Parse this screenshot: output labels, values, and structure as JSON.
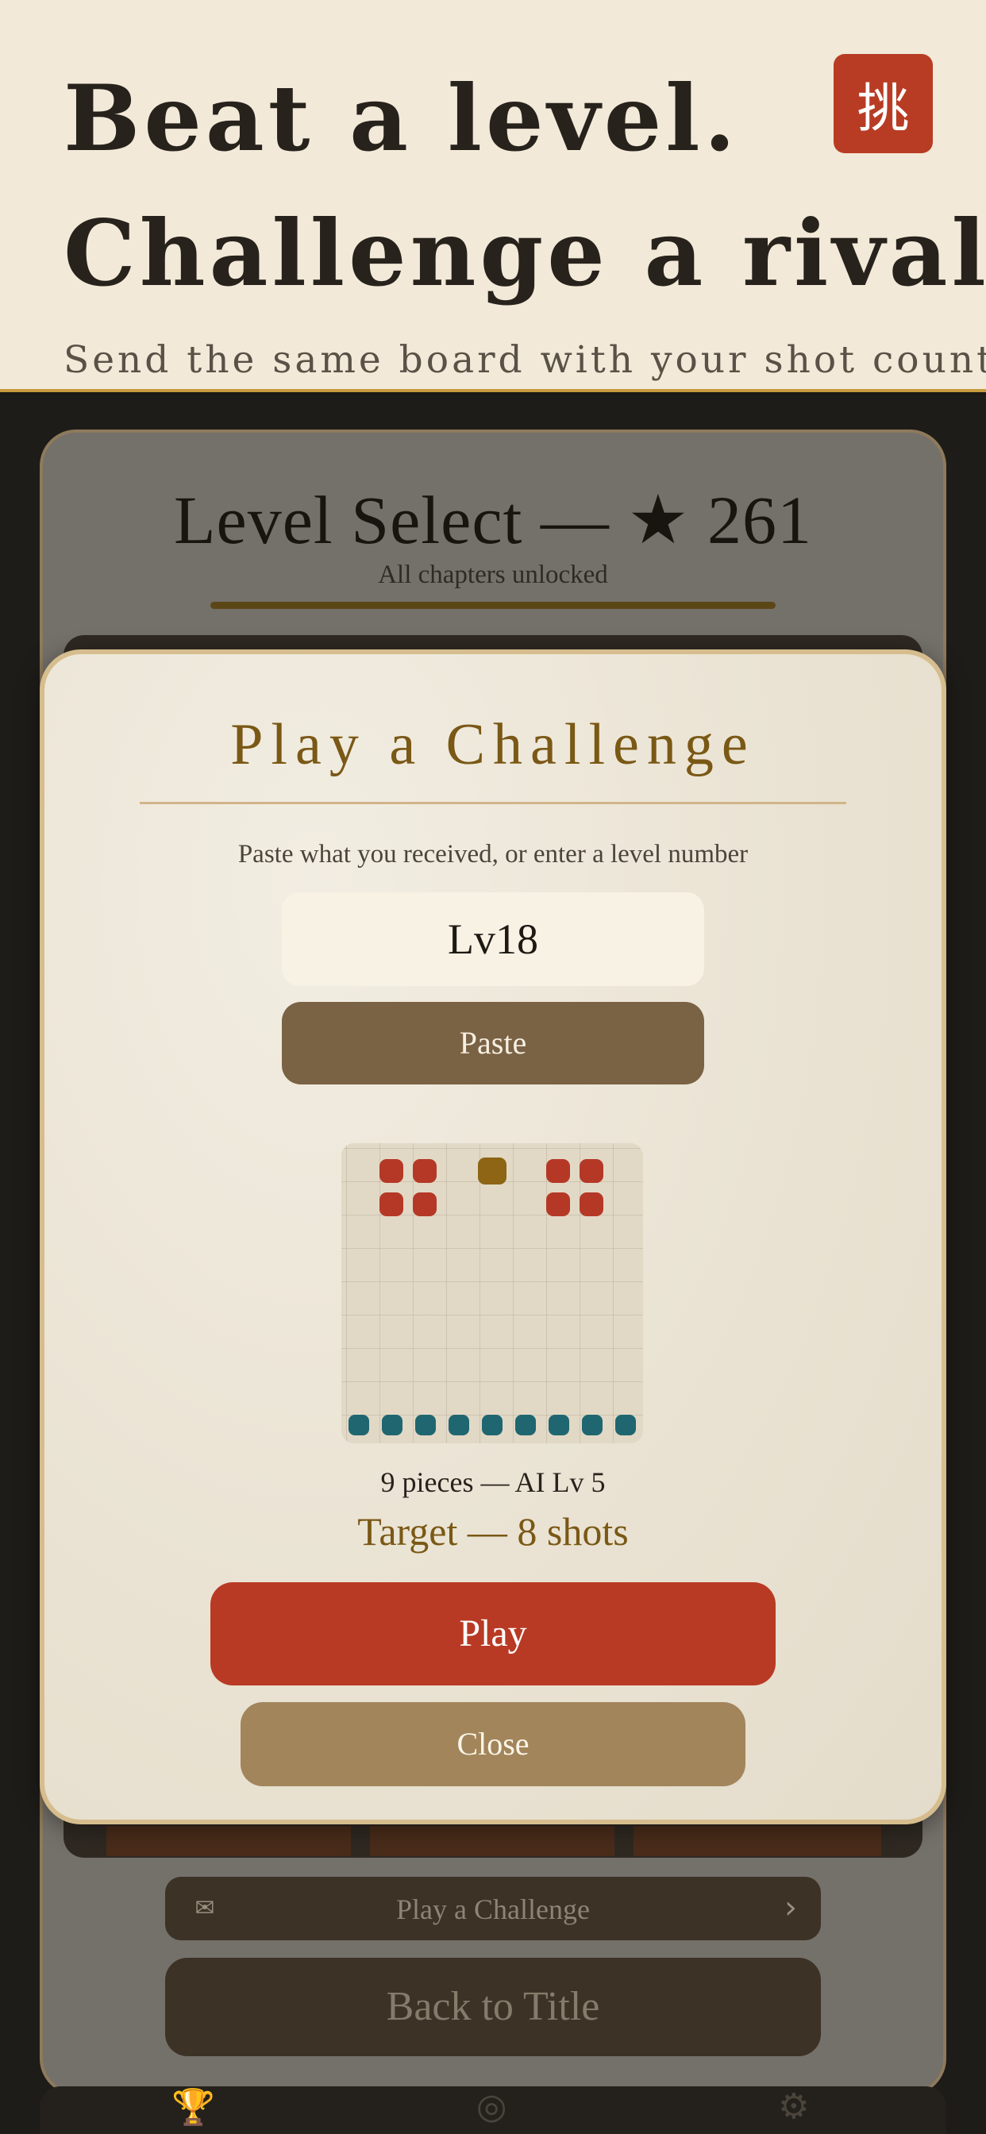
{
  "promo": {
    "headline_line1": "Beat a level.",
    "headline_line2": "Challenge a rival.",
    "subline": "Send the same board with your shot count",
    "seal_glyph": "挑"
  },
  "level_select": {
    "title": "Level Select — ★ 261",
    "subtitle": "All chapters unlocked",
    "challenge_link_label": "Play a Challenge",
    "back_label": "Back to Title"
  },
  "modal": {
    "title": "Play a Challenge",
    "hint": "Paste what you received, or enter a level number",
    "input_value": "Lv18",
    "paste_label": "Paste",
    "pieces_info": "9 pieces — AI Lv 5",
    "target_info": "Target — 8 shots",
    "play_label": "Play",
    "close_label": "Close"
  },
  "board": {
    "red_pieces": 8,
    "gold_pieces": 1,
    "teal_pieces": 9
  },
  "colors": {
    "accent_red": "#b93a24",
    "gold": "#7a5815",
    "teal": "#1f6670",
    "paper": "#f2e9d8"
  }
}
